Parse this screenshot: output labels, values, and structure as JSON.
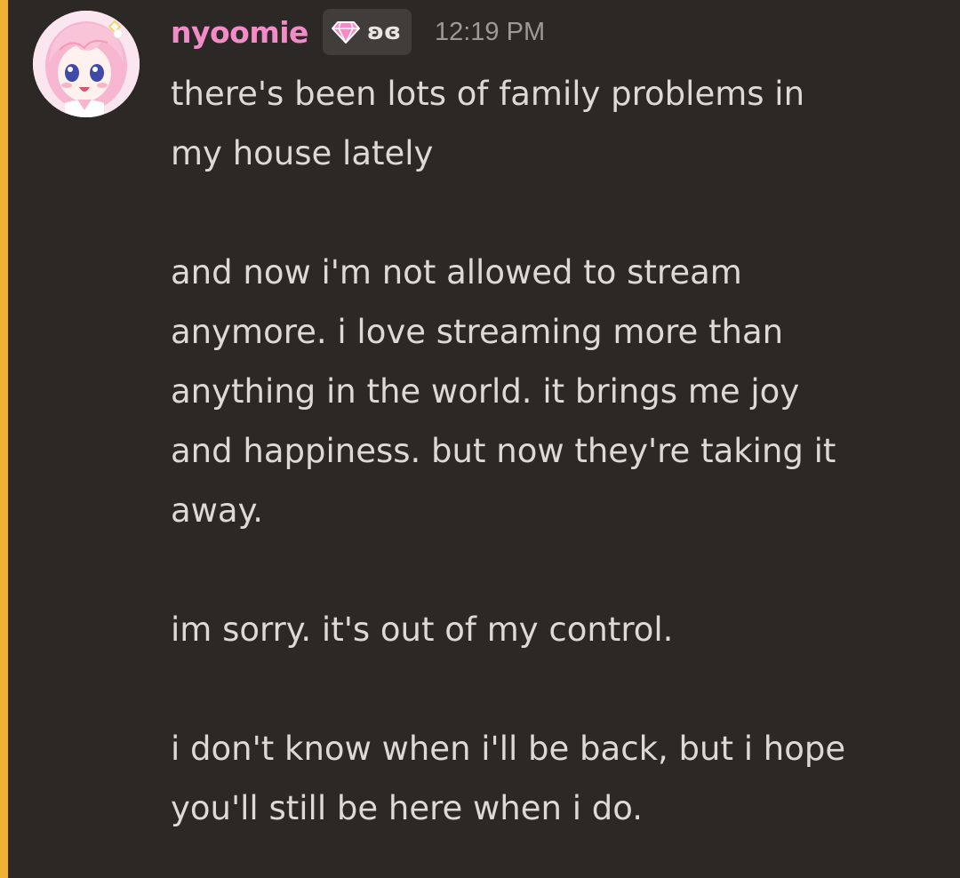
{
  "message": {
    "author": {
      "username": "nyoomie",
      "name_color": "#f28bc8",
      "avatar_icon": "anime-girl-avatar"
    },
    "clan_tag": {
      "icon": "pink-gem-icon",
      "text": "ʚɞ"
    },
    "timestamp": "12:19 PM",
    "mention_highlight_color": "#f0b232",
    "lines": [
      "there's been lots of family problems in",
      "my house lately",
      "and now i'm not allowed to stream",
      "anymore. i love streaming more than",
      "anything in the world. it brings me joy",
      "and happiness. but now they're taking it",
      "away.",
      "im sorry. it's out of my control.",
      "i don't know when i'll be back, but i hope",
      "you'll still be here when i do."
    ]
  }
}
